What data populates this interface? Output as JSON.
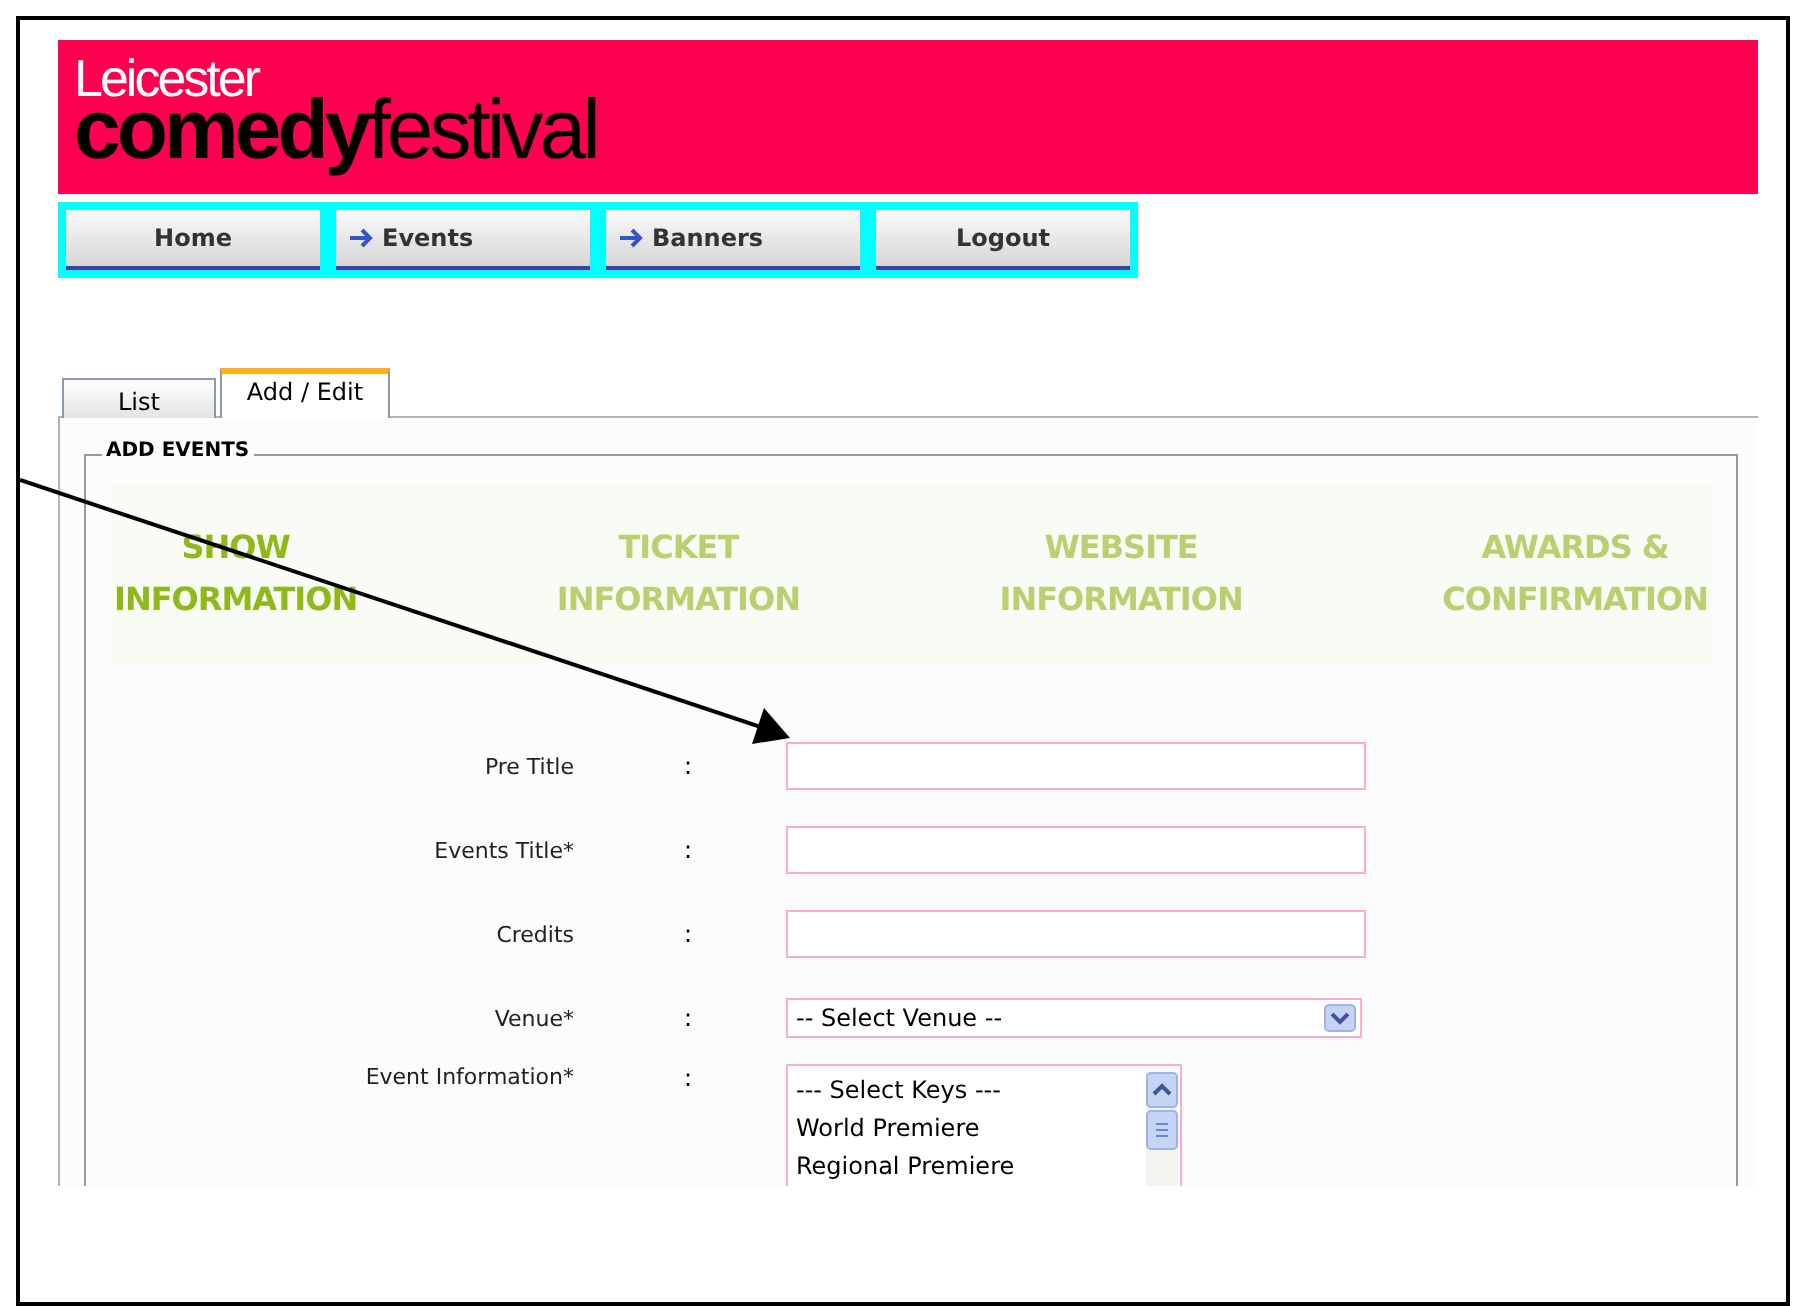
{
  "logo": {
    "top": "Leicester",
    "bold": "comedy",
    "rest": "festival"
  },
  "nav": [
    {
      "label": "Home",
      "arrow": false
    },
    {
      "label": "Events",
      "arrow": true
    },
    {
      "label": "Banners",
      "arrow": true
    },
    {
      "label": "Logout",
      "arrow": false
    }
  ],
  "tabs": [
    {
      "label": "List",
      "selected": false
    },
    {
      "label": "Add / Edit",
      "selected": true
    }
  ],
  "section_title": "ADD EVENTS",
  "steps": [
    {
      "line1": "SHOW",
      "line2": "INFORMATION",
      "selected": true
    },
    {
      "line1": "TICKET",
      "line2": "INFORMATION",
      "selected": false
    },
    {
      "line1": "WEBSITE",
      "line2": "INFORMATION",
      "selected": false
    },
    {
      "line1": "AWARDS &",
      "line2": "CONFIRMATION",
      "selected": false
    }
  ],
  "fields": [
    {
      "kind": "text",
      "label": "Pre Title",
      "colon": ":"
    },
    {
      "kind": "text",
      "label": "Events Title*",
      "colon": ":"
    },
    {
      "kind": "text",
      "label": "Credits",
      "colon": ":"
    },
    {
      "kind": "select",
      "label": "Venue*",
      "colon": ":",
      "value": "-- Select Venue --"
    },
    {
      "kind": "list",
      "label": "Event Information*",
      "colon": ":",
      "options": [
        "--- Select Keys ---",
        "World Premiere",
        "Regional Premiere"
      ]
    }
  ]
}
